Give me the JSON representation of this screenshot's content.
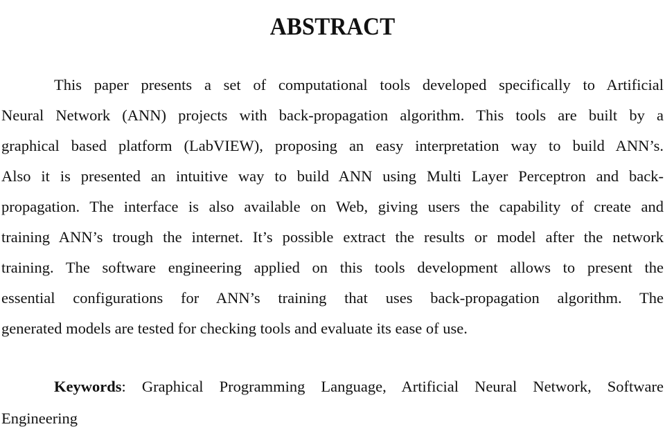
{
  "document": {
    "title": "ABSTRACT",
    "abstract_lines": [
      "This paper presents a set of computational tools developed specifically to Artificial",
      "Neural Network (ANN) projects with back-propagation algorithm. This tools are built by a",
      "graphical based platform (LabVIEW), proposing an easy interpretation way to build ANN’s.",
      "Also it is presented an intuitive way to build ANN using Multi Layer Perceptron and back-",
      "propagation. The interface is also available on Web, giving users the capability of create and",
      "training ANN’s trough the internet. It’s possible extract the results or model after the network",
      "training. The software engineering applied on this tools development allows to present the",
      "essential configurations for ANN’s training that uses back-propagation algorithm. The",
      "generated models are tested for checking tools and evaluate its ease of use."
    ],
    "keywords": {
      "label": "Keywords",
      "separator": ":",
      "text_line1": "Graphical Programming Language, Artificial Neural Network, Software",
      "text_line2": "Engineering"
    }
  }
}
